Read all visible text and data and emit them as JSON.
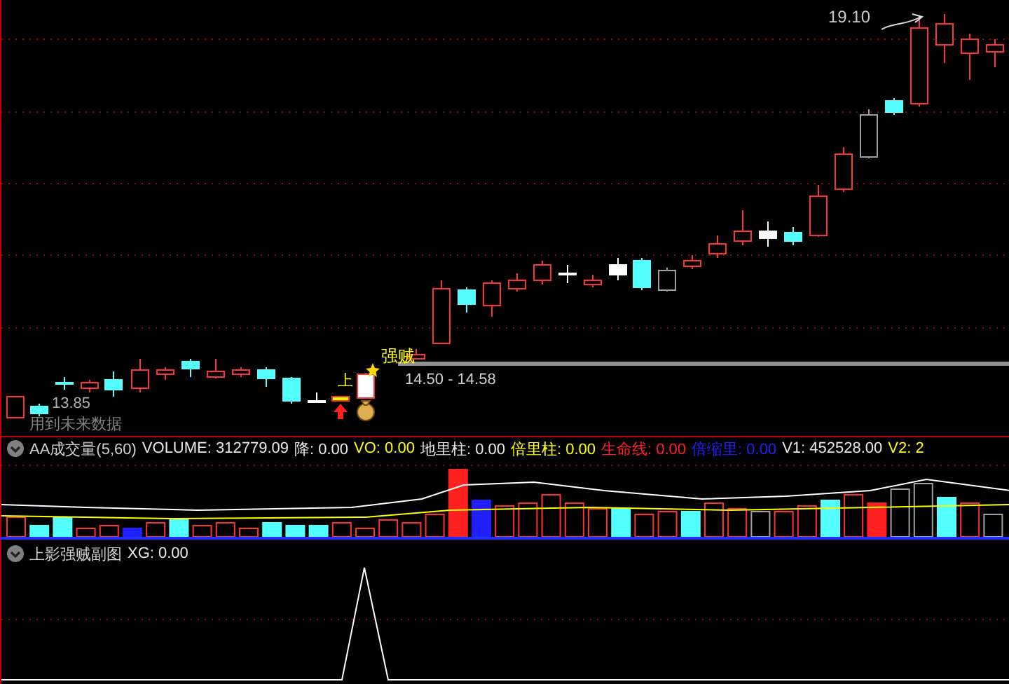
{
  "main_chart": {
    "high_label": "19.10",
    "range_label": "14.50 - 14.58",
    "low_label": "13.85",
    "signal_label": "强贼",
    "up_label": "上",
    "notice": "用到未来数据"
  },
  "volume_panel": {
    "title": "AA成交量(5,60)",
    "indicators": [
      {
        "label": "VOLUME: 312779.09",
        "color": "#e8e8e8"
      },
      {
        "label": "降: 0.00",
        "color": "#e8e8e8"
      },
      {
        "label": "VO: 0.00",
        "color": "#ffff00"
      },
      {
        "label": "地里柱: 0.00",
        "color": "#e8e8e8"
      },
      {
        "label": "倍里柱: 0.00",
        "color": "#ffff00"
      },
      {
        "label": "生命线: 0.00",
        "color": "#ff2020"
      },
      {
        "label": "倍缩里: 0.00",
        "color": "#2020ff"
      },
      {
        "label": "V1: 452528.00",
        "color": "#e8e8e8"
      },
      {
        "label": "V2: 2",
        "color": "#ffff00"
      }
    ]
  },
  "signal_panel": {
    "title": "上影强贼副图",
    "indicators": [
      {
        "label": "XG: 0.00",
        "color": "#e8e8e8"
      }
    ]
  }
}
